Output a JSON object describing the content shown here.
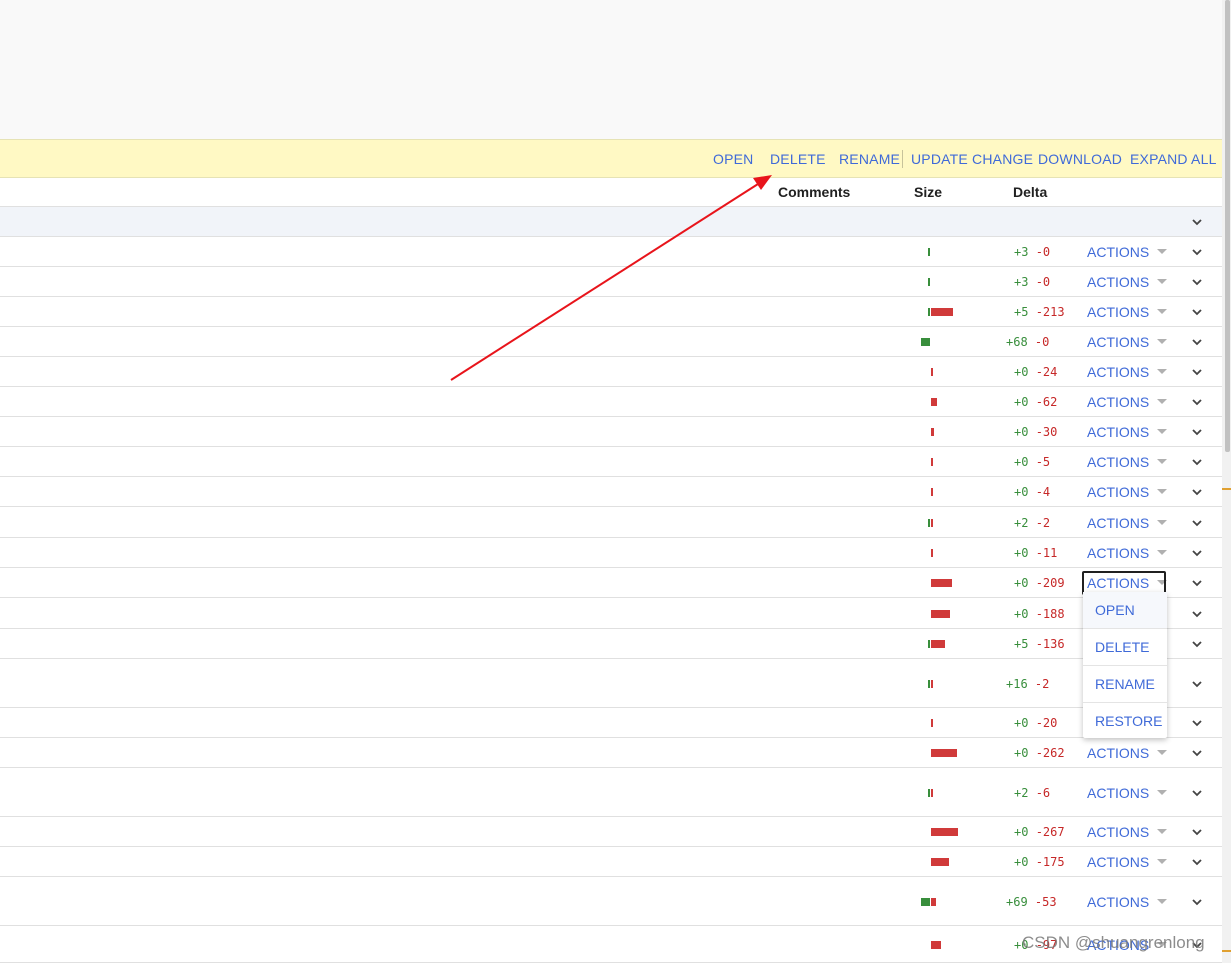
{
  "toolbar": {
    "open": "OPEN",
    "delete": "DELETE",
    "rename": "RENAME",
    "update_change": "UPDATE CHANGE",
    "download": "DOWNLOAD",
    "expand_all": "EXPAND ALL"
  },
  "header": {
    "comments": "Comments",
    "size": "Size",
    "delta": "Delta"
  },
  "files": [
    {
      "added": "+3",
      "removed": "-0",
      "actions": "ACTIONS"
    },
    {
      "added": "+3",
      "removed": "-0",
      "actions": "ACTIONS"
    },
    {
      "added": "+5",
      "removed": "-213",
      "actions": "ACTIONS"
    },
    {
      "added": "+68",
      "removed": "-0",
      "actions": "ACTIONS"
    },
    {
      "added": "+0",
      "removed": "-24",
      "actions": "ACTIONS"
    },
    {
      "added": "+0",
      "removed": "-62",
      "actions": "ACTIONS"
    },
    {
      "added": "+0",
      "removed": "-30",
      "actions": "ACTIONS"
    },
    {
      "added": "+0",
      "removed": "-5",
      "actions": "ACTIONS"
    },
    {
      "added": "+0",
      "removed": "-4",
      "actions": "ACTIONS"
    },
    {
      "added": "+2",
      "removed": "-2",
      "actions": "ACTIONS"
    },
    {
      "added": "+0",
      "removed": "-11",
      "actions": "ACTIONS"
    },
    {
      "added": "+0",
      "removed": "-209",
      "actions": "ACTIONS"
    },
    {
      "added": "+0",
      "removed": "-188",
      "actions": ""
    },
    {
      "added": "+5",
      "removed": "-136",
      "actions": ""
    },
    {
      "added": "+16",
      "removed": "-2",
      "actions": ""
    },
    {
      "added": "+0",
      "removed": "-20",
      "actions": ""
    },
    {
      "added": "+0",
      "removed": "-262",
      "actions": "ACTIONS"
    },
    {
      "added": "+2",
      "removed": "-6",
      "actions": "ACTIONS"
    },
    {
      "added": "+0",
      "removed": "-267",
      "actions": "ACTIONS"
    },
    {
      "added": "+0",
      "removed": "-175",
      "actions": "ACTIONS"
    },
    {
      "added": "+69",
      "removed": "-53",
      "actions": "ACTIONS"
    },
    {
      "added": "+0",
      "removed": "-97",
      "actions": "ACTIONS"
    }
  ],
  "actions_menu": {
    "open": "OPEN",
    "delete": "DELETE",
    "rename": "RENAME",
    "restore": "RESTORE"
  },
  "watermark": "CSDN @shuangrenlong",
  "colors": {
    "toolbar_bg": "#fff9c4",
    "link_blue": "#3f6ad8",
    "added_green": "#388e3c",
    "removed_red": "#d03a3a",
    "annotation_arrow": "#e8141b"
  },
  "icons": {
    "row_expand": "chevron-down-icon",
    "actions_dropdown": "caret-down-icon"
  }
}
